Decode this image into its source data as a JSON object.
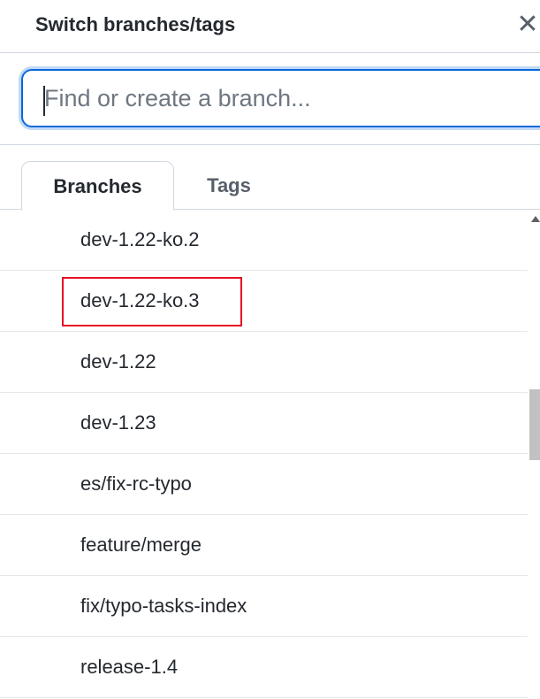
{
  "dialog": {
    "title": "Switch branches/tags",
    "close_icon": "close-icon",
    "close_glyph": "✕"
  },
  "search": {
    "placeholder": "Find or create a branch...",
    "value": ""
  },
  "tabs": [
    {
      "label": "Branches",
      "active": true
    },
    {
      "label": "Tags",
      "active": false
    }
  ],
  "branches": [
    {
      "name": "dev-1.22-ko.2"
    },
    {
      "name": "dev-1.22-ko.3",
      "highlighted": true
    },
    {
      "name": "dev-1.22"
    },
    {
      "name": "dev-1.23"
    },
    {
      "name": "es/fix-rc-typo"
    },
    {
      "name": "feature/merge"
    },
    {
      "name": "fix/typo-tasks-index"
    },
    {
      "name": "release-1.4"
    }
  ],
  "colors": {
    "focus_border": "#0969da",
    "highlight": "#e81123"
  }
}
